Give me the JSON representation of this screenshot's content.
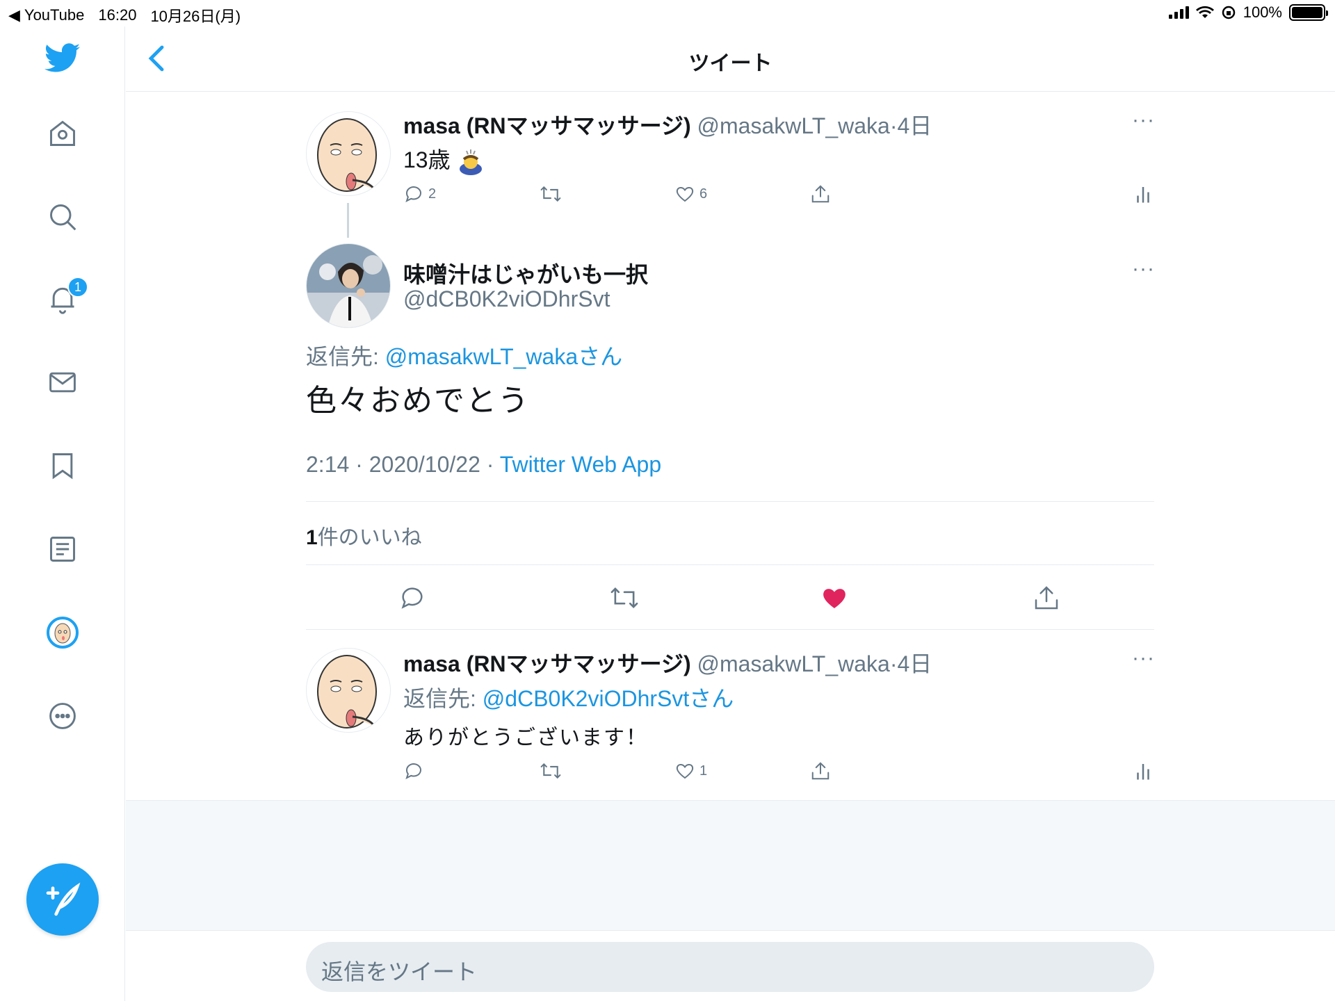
{
  "status_bar": {
    "back_app": "YouTube",
    "time": "16:20",
    "date": "10月26日(月)",
    "battery": "100%"
  },
  "sidebar": {
    "notification_badge": "1"
  },
  "header": {
    "title": "ツイート"
  },
  "parent_tweet": {
    "name": "masa (RNマッサマッサージ)",
    "handle": "@masakwLT_waka",
    "separator": "·",
    "time": "4日",
    "text": "13歳",
    "replies": "2",
    "likes": "6",
    "more": "···"
  },
  "focus_tweet": {
    "name": "味噌汁はじゃがいも一択",
    "handle": "@dCB0K2viODhrSvt",
    "reply_prefix": "返信先: ",
    "reply_to": "@masakwLT_wakaさん",
    "text": "色々おめでとう",
    "timestamp": "2:14 · 2020/10/22 · ",
    "source": "Twitter Web App",
    "likes_count": "1",
    "likes_label": "件のいいね",
    "more": "···",
    "liked": true,
    "like_color": "#e0245e"
  },
  "reply_tweet": {
    "name": "masa (RNマッサマッサージ)",
    "handle": "@masakwLT_waka",
    "separator": "·",
    "time": "4日",
    "reply_prefix": "返信先: ",
    "reply_to": "@dCB0K2viODhrSvtさん",
    "text": "ありがとうございます！",
    "replies": "",
    "likes": "1",
    "more": "···"
  },
  "reply_box": {
    "placeholder": "返信をツイート"
  },
  "colors": {
    "accent": "#1da1f2",
    "link": "#1b95e0",
    "muted": "#657786",
    "like": "#e0245e"
  }
}
